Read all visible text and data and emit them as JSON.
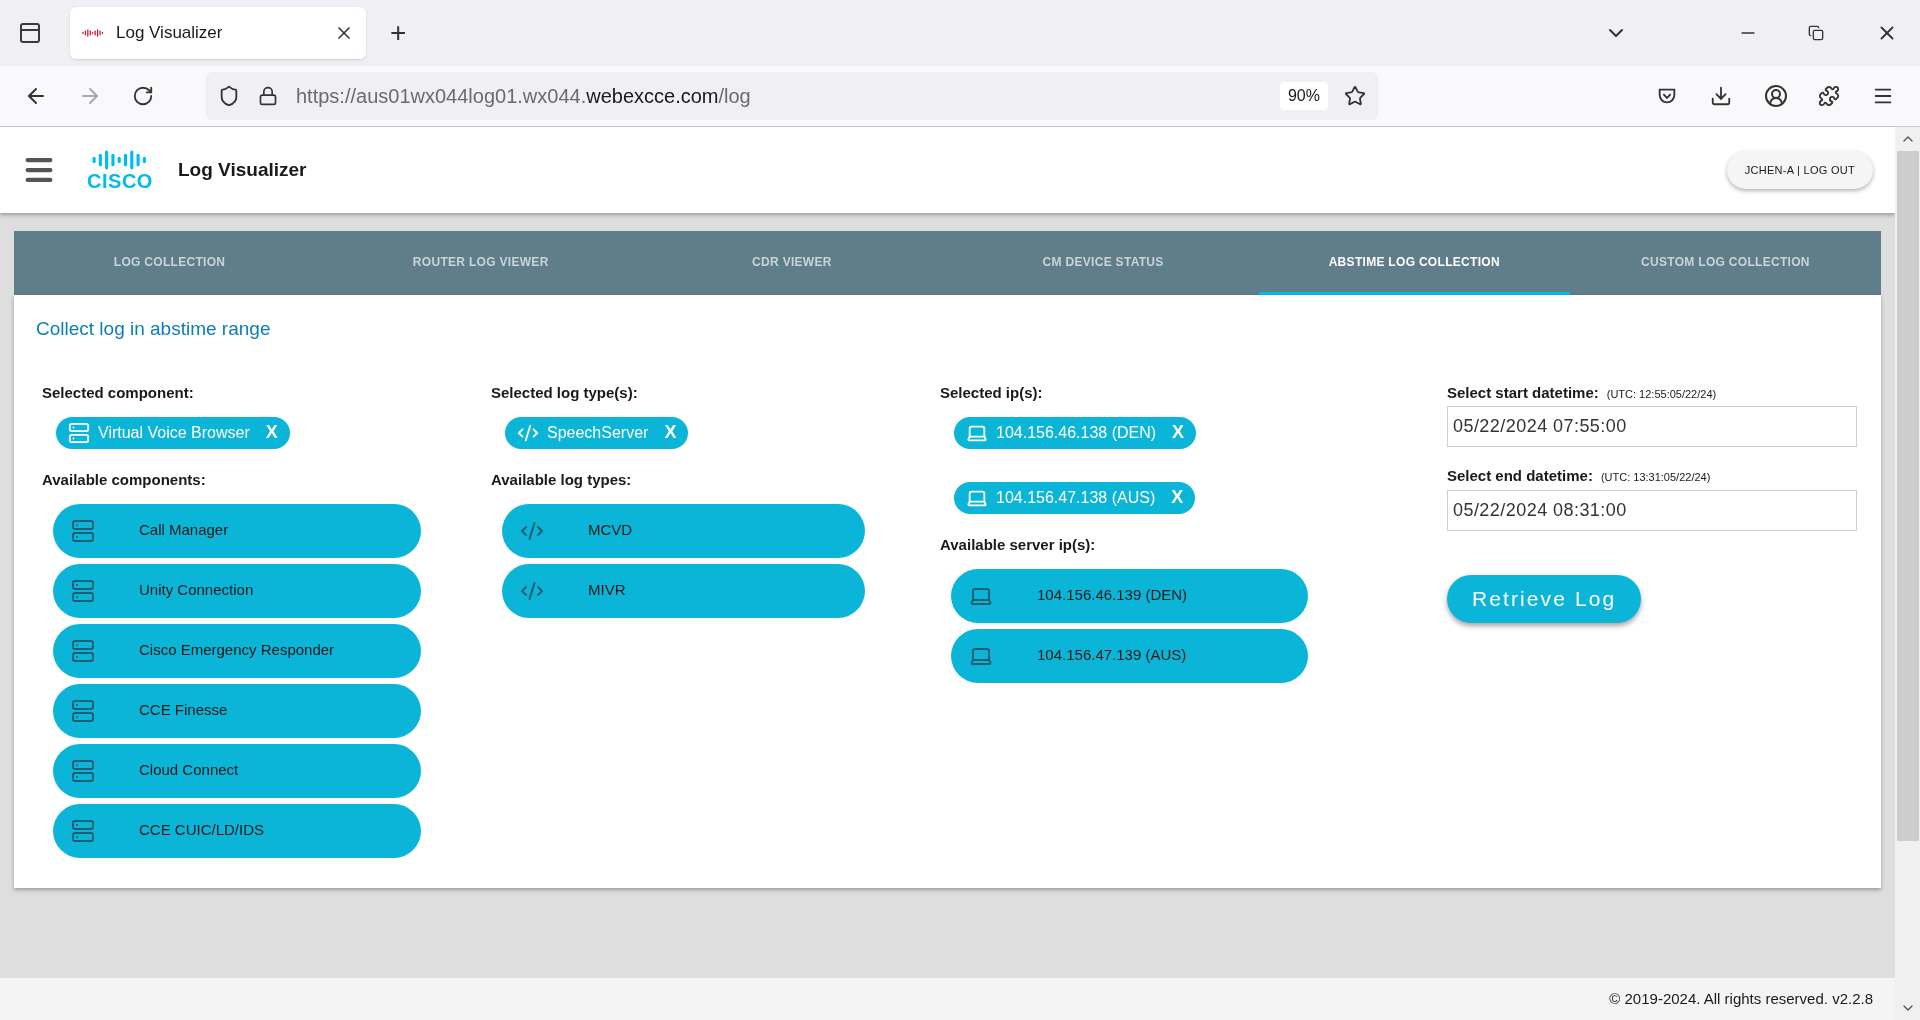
{
  "browser": {
    "tabs": [
      {
        "title": "Log Visualizer",
        "selected": true
      }
    ],
    "new_tab": "+",
    "url": {
      "prefix": "https://aus01wx044log01.wx044.",
      "domain": "webexcce.com",
      "path": "/log"
    },
    "zoom": "90%"
  },
  "header": {
    "logo_text": "CISCO",
    "title": "Log Visualizer",
    "user_button": "JCHEN-A | LOG OUT"
  },
  "nav_tabs": [
    {
      "label": "LOG COLLECTION",
      "selected": false
    },
    {
      "label": "ROUTER LOG VIEWER",
      "selected": false
    },
    {
      "label": "CDR VIEWER",
      "selected": false
    },
    {
      "label": "CM DEVICE STATUS",
      "selected": false
    },
    {
      "label": "ABSTIME LOG COLLECTION",
      "selected": true
    },
    {
      "label": "CUSTOM LOG COLLECTION",
      "selected": false
    }
  ],
  "panel": {
    "heading": "Collect log in abstime range",
    "sections": [
      {
        "kind": "component",
        "selected_label": "Selected component:",
        "selected": [
          {
            "label": "Virtual Voice Browser",
            "remove": "X"
          }
        ],
        "available_label": "Available components:",
        "available": [
          "Call Manager",
          "Unity Connection",
          "Cisco Emergency Responder",
          "CCE Finesse",
          "Cloud Connect",
          "CCE CUIC/LD/IDS"
        ]
      },
      {
        "kind": "log_type",
        "selected_label": "Selected log type(s):",
        "selected": [
          {
            "label": "SpeechServer",
            "remove": "X"
          }
        ],
        "available_label": "Available log types:",
        "available": [
          "MCVD",
          "MIVR"
        ]
      },
      {
        "kind": "ip",
        "selected_label": "Selected ip(s):",
        "selected": [
          {
            "label": "104.156.46.138 (DEN)",
            "remove": "X"
          },
          {
            "label": "104.156.47.138 (AUS)",
            "remove": "X"
          }
        ],
        "available_label": "Available server ip(s):",
        "available": [
          "104.156.46.139 (DEN)",
          "104.156.47.139 (AUS)"
        ]
      }
    ],
    "datetimes": [
      {
        "label": "Select start datetime:",
        "utc": "(UTC: 12:55:05/22/24)",
        "value": "05/22/2024 07:55:00"
      },
      {
        "label": "Select end datetime:",
        "utc": "(UTC: 13:31:05/22/24)",
        "value": "05/22/2024 08:31:00"
      }
    ],
    "retrieve_button": "Retrieve Log"
  },
  "footer": "© 2019-2024. All rights reserved. v2.2.8"
}
